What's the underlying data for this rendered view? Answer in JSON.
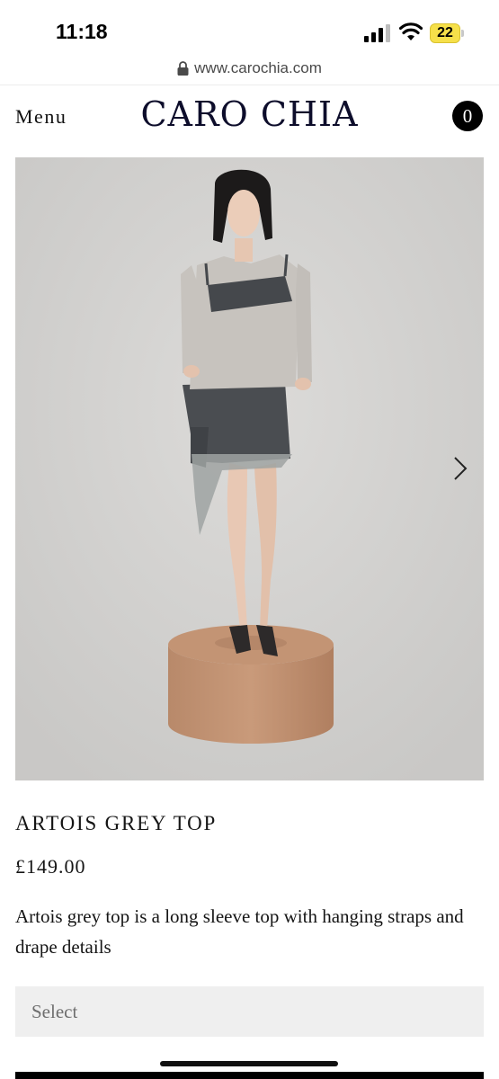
{
  "status_bar": {
    "time": "11:18",
    "battery_level": "22",
    "icons": [
      "signal-icon",
      "wifi-icon",
      "battery-icon"
    ]
  },
  "browser": {
    "url": "www.carochia.com",
    "icon": "lock-icon"
  },
  "header": {
    "menu_label": "Menu",
    "brand": "CARO CHIA",
    "cart_count": "0"
  },
  "product": {
    "image_icon": "product-photo",
    "next_icon": "chevron-right-icon",
    "title": "ARTOIS GREY TOP",
    "price": "£149.00",
    "description": "Artois grey top is a long sleeve top with hanging straps and drape details",
    "variant_placeholder": "Select"
  },
  "colors": {
    "select_background": "#efefef",
    "photo_background": "#d7d6d4",
    "battery": "#f6e04a"
  }
}
